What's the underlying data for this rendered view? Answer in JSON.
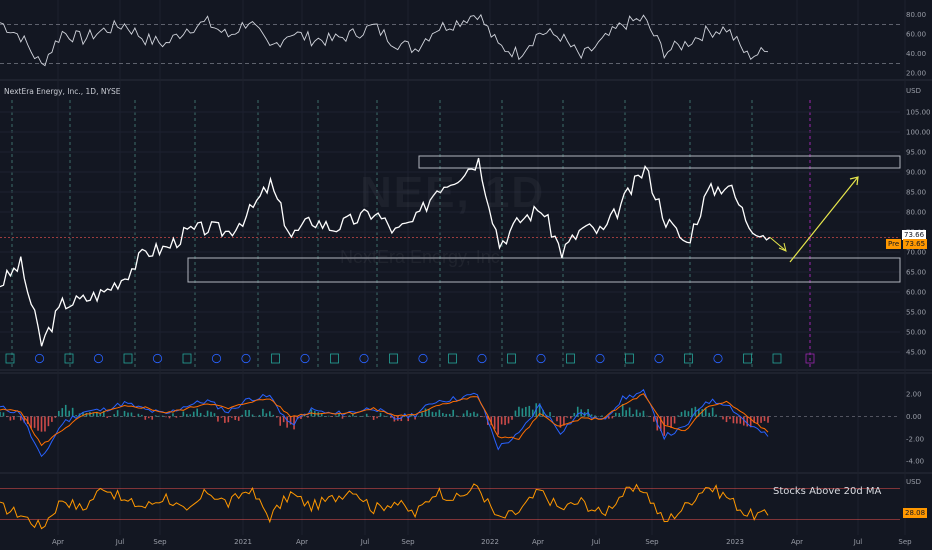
{
  "chart_title": "NextEra Energy, Inc., 1D, NYSE",
  "watermark_symbol": "NEE, 1D",
  "watermark_name": "NextEra Energy, Inc.",
  "currency": "USD",
  "indicator_label": "Stocks Above 20d MA",
  "price_tags": {
    "last": "73.66",
    "pre_label": "Pre",
    "pre_value": "73.65"
  },
  "bottom_last": "28.08",
  "colors": {
    "price": "#ffffff",
    "rsi": "#d1d4dc",
    "macd": "#2962ff",
    "signal": "#ff6d00",
    "hist_up": "#26a69a",
    "hist_down": "#ef5350",
    "breadth": "#ff9800",
    "arrow": "#e6e64c",
    "zone": "#b2b5be",
    "background": "#131722"
  },
  "chart_data": [
    {
      "type": "line",
      "panel": "rsi",
      "ylim": [
        15,
        90
      ],
      "yticks": [
        "80.00",
        "60.00",
        "40.00",
        "20.00"
      ],
      "levels": [
        70,
        30
      ],
      "x": [
        "2020-01",
        "2020-02",
        "2020-03",
        "2020-04",
        "2020-05",
        "2020-06",
        "2020-07",
        "2020-08",
        "2020-09",
        "2020-10",
        "2020-11",
        "2020-12",
        "2021-01",
        "2021-02",
        "2021-03",
        "2021-04",
        "2021-05",
        "2021-06",
        "2021-07",
        "2021-08",
        "2021-09",
        "2021-10",
        "2021-11",
        "2021-12",
        "2022-01",
        "2022-02",
        "2022-03",
        "2022-04",
        "2022-05",
        "2022-06",
        "2022-07",
        "2022-08",
        "2022-09",
        "2022-10",
        "2022-11",
        "2022-12",
        "2023-01",
        "2023-02"
      ],
      "values": [
        72,
        58,
        28,
        62,
        55,
        64,
        70,
        55,
        50,
        66,
        72,
        58,
        74,
        45,
        62,
        55,
        54,
        60,
        68,
        52,
        45,
        66,
        72,
        82,
        48,
        40,
        62,
        58,
        36,
        52,
        70,
        76,
        42,
        50,
        62,
        66,
        38,
        42
      ]
    },
    {
      "type": "line",
      "panel": "price",
      "ylim": [
        43,
        108
      ],
      "yticks": [
        "105.00",
        "100.00",
        "95.00",
        "90.00",
        "85.00",
        "80.00",
        "75.00",
        "70.00",
        "65.00",
        "60.00",
        "55.00",
        "50.00",
        "45.00"
      ],
      "x": [
        "2020-01",
        "2020-02",
        "2020-03",
        "2020-04",
        "2020-05",
        "2020-06",
        "2020-07",
        "2020-08",
        "2020-09",
        "2020-10",
        "2020-11",
        "2020-12",
        "2021-01",
        "2021-02",
        "2021-03",
        "2021-04",
        "2021-05",
        "2021-06",
        "2021-07",
        "2021-08",
        "2021-09",
        "2021-10",
        "2021-11",
        "2021-12",
        "2022-01",
        "2022-02",
        "2022-03",
        "2022-04",
        "2022-05",
        "2022-06",
        "2022-07",
        "2022-08",
        "2022-09",
        "2022-10",
        "2022-11",
        "2022-12",
        "2023-01",
        "2023-02"
      ],
      "values": [
        62,
        67,
        47,
        57,
        58,
        60,
        64,
        70,
        71,
        75,
        76,
        75,
        80,
        87,
        74,
        78,
        76,
        78,
        80,
        75,
        78,
        86,
        89,
        93,
        72,
        78,
        81,
        70,
        76,
        75,
        83,
        91,
        78,
        72,
        85,
        87,
        77,
        73.66
      ],
      "zones": [
        {
          "low": 91,
          "high": 94
        },
        {
          "low": 62.5,
          "high": 68.5
        }
      ],
      "last": 73.66
    },
    {
      "type": "bar",
      "panel": "macd",
      "ylim": [
        -4.8,
        3.0
      ],
      "yticks": [
        "2.00",
        "0.00",
        "-2.00",
        "-4.00"
      ],
      "series": [
        {
          "name": "",
          "values": [
            0.8,
            0.3,
            -3.8,
            -0.6,
            0.4,
            0.6,
            1.2,
            0.6,
            0.2,
            1.0,
            1.4,
            0.4,
            1.6,
            1.8,
            -0.8,
            0.6,
            0.2,
            0.4,
            0.8,
            -0.2,
            0.2,
            1.4,
            1.6,
            2.0,
            -2.8,
            -1.6,
            1.0,
            -1.4,
            0.4,
            -0.4,
            1.6,
            2.2,
            -1.8,
            -1.0,
            1.4,
            1.2,
            -0.6,
            -1.8
          ]
        },
        {
          "name": "",
          "values": [
            0.6,
            0.5,
            -2.6,
            -1.2,
            0.1,
            0.4,
            0.9,
            0.8,
            0.3,
            0.7,
            1.2,
            0.7,
            1.3,
            1.6,
            0.0,
            0.3,
            0.3,
            0.3,
            0.7,
            0.1,
            0.1,
            1.0,
            1.4,
            1.8,
            -1.8,
            -2.0,
            0.2,
            -0.9,
            -0.2,
            -0.2,
            1.0,
            2.0,
            -0.8,
            -1.3,
            0.8,
            1.3,
            0.0,
            -1.4
          ]
        }
      ]
    },
    {
      "type": "line",
      "panel": "breadth",
      "ylim": [
        0,
        100
      ],
      "values": [
        45,
        30,
        5,
        60,
        40,
        85,
        55,
        45,
        65,
        30,
        75,
        50,
        80,
        25,
        70,
        45,
        60,
        80,
        40,
        55,
        30,
        75,
        60,
        85,
        20,
        35,
        75,
        40,
        55,
        30,
        70,
        80,
        15,
        45,
        85,
        65,
        30,
        28
      ],
      "last": 28.08
    }
  ],
  "x_axis": {
    "labels": [
      "Apr",
      "Jul",
      "Sep",
      "2021",
      "Apr",
      "Jul",
      "Sep",
      "2022",
      "Apr",
      "Jul",
      "Sep",
      "2023",
      "Apr",
      "Jul",
      "Sep"
    ]
  },
  "event_markers": [
    "E",
    "D",
    "E",
    "D",
    "E",
    "D",
    "E",
    "D",
    "D",
    "E",
    "D",
    "E",
    "D",
    "E",
    "D",
    "E",
    "D",
    "E",
    "D",
    "E",
    "D",
    "E",
    "D",
    "E",
    "D",
    "E",
    "E"
  ]
}
